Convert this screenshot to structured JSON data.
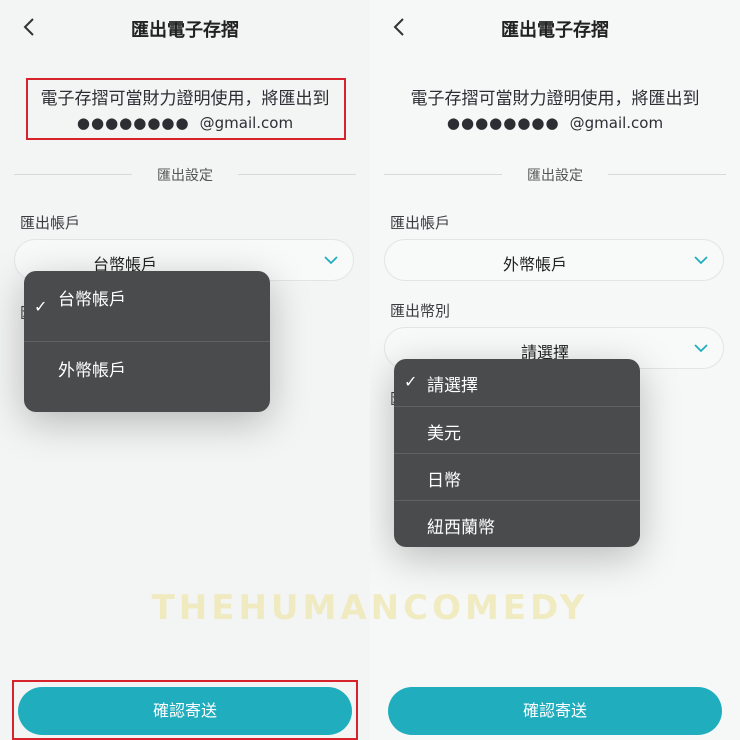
{
  "left": {
    "header": {
      "back_icon": "chevron-left-icon",
      "title": "匯出電子存摺"
    },
    "notice": {
      "line1": "電子存摺可當財力證明使用，將匯出到",
      "masked": "●●●●●●●●",
      "domain": "@gmail.com"
    },
    "section_title": "匯出設定",
    "account": {
      "label": "匯出帳戶",
      "value": "台幣帳戶"
    },
    "dropdown": {
      "options": [
        "台幣帳戶",
        "外幣帳戶"
      ],
      "selected_index": 0,
      "check_glyph": "✓"
    },
    "hidden_label_initial": "匯",
    "confirm_label": "確認寄送",
    "highlight_color": "#d6222b"
  },
  "right": {
    "header": {
      "back_icon": "chevron-left-icon",
      "title": "匯出電子存摺"
    },
    "notice": {
      "line1": "電子存摺可當財力證明使用，將匯出到",
      "masked": "●●●●●●●●",
      "domain": "@gmail.com"
    },
    "section_title": "匯出設定",
    "account": {
      "label": "匯出帳戶",
      "value": "外幣帳戶"
    },
    "currency": {
      "label": "匯出幣別",
      "value": "請選擇"
    },
    "dropdown": {
      "options": [
        "請選擇",
        "美元",
        "日幣",
        "紐西蘭幣"
      ],
      "selected_index": 0,
      "check_glyph": "✓"
    },
    "hidden_label_initial": "匯",
    "confirm_label": "確認寄送"
  },
  "watermark": "THEHUMANCOMEDY",
  "accent_color": "#20aebf",
  "chevron_color": "#20aebf"
}
